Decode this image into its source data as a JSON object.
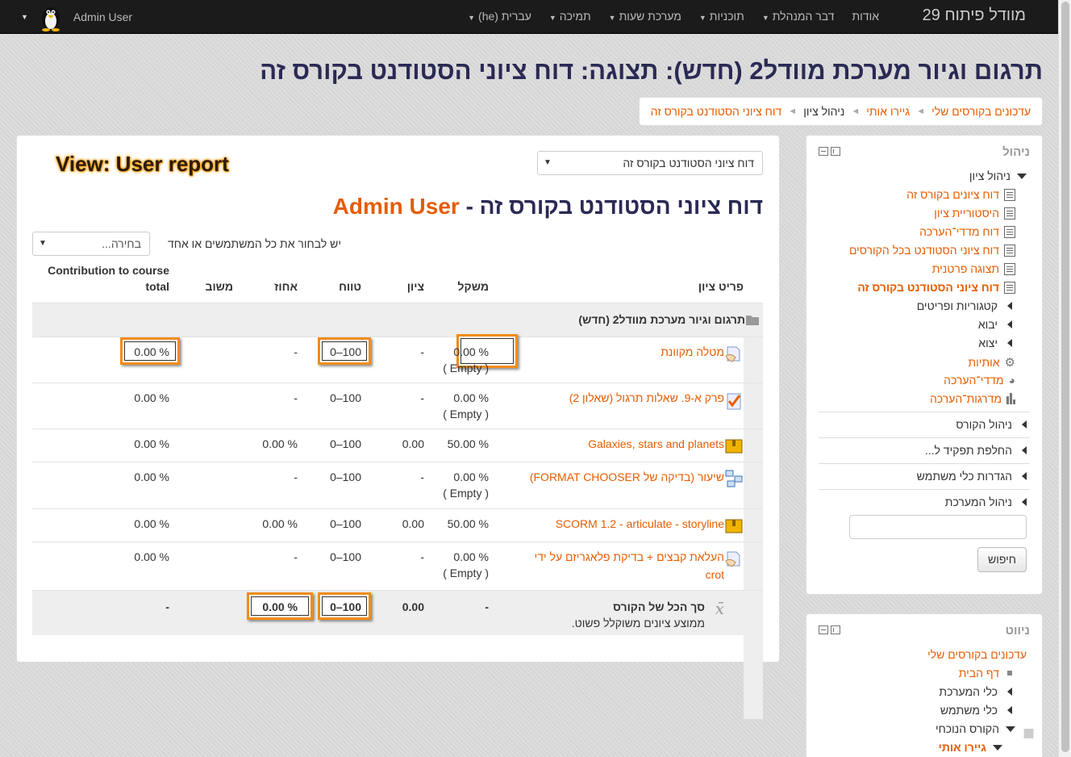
{
  "navbar": {
    "brand": "מוודל פיתוח 29",
    "menu": [
      {
        "label": "אודות",
        "caret": false
      },
      {
        "label": "דבר המנהלת",
        "caret": true
      },
      {
        "label": "תוכניות",
        "caret": true
      },
      {
        "label": "מערכת שעות",
        "caret": true
      },
      {
        "label": "תמיכה",
        "caret": true
      },
      {
        "label": "עברית (he)",
        "caret": true
      }
    ],
    "user_name": "Admin User"
  },
  "page_title": "תרגום וגיור מערכת מוודל2 (חדש): תצוגה: דוח ציוני הסטודנט בקורס זה",
  "breadcrumb": [
    "עדכונים בקורסים שלי",
    "גיירו אותי",
    "ניהול ציון",
    "דוח ציוני הסטודנט בקורס זה"
  ],
  "main": {
    "view_label": "View: User report",
    "report_select": "דוח ציוני הסטודנט בקורס זה",
    "heading_prefix": "דוח ציוני הסטודנט בקורס זה - ",
    "heading_user": "Admin User",
    "user_select_label": "יש לבחור את כל המשתמשים או אחד",
    "user_select_value": "בחירה...",
    "columns": {
      "item": "פריט ציון",
      "weight": "משקל",
      "grade": "ציון",
      "range": "טווח",
      "percentage": "אחוז",
      "feedback": "משוב",
      "contribution_line1": "Contribution to course",
      "contribution_line2": "total"
    },
    "category": "תרגום וגיור מערכת מוודל2 (חדש)",
    "rows": [
      {
        "name": "מטלה מקוונת",
        "weight": "0.00 %",
        "weight_note": "( Empty )",
        "grade": "-",
        "range": "0–100",
        "percentage": "-",
        "contribution": "0.00 %"
      },
      {
        "name": "פרק א-9. שאלות תרגול (שאלון 2)",
        "weight": "0.00 %",
        "weight_note": "( Empty )",
        "grade": "-",
        "range": "0–100",
        "percentage": "-",
        "contribution": "0.00 %"
      },
      {
        "name": "Galaxies, stars and planets",
        "weight": "50.00 %",
        "weight_note": "",
        "grade": "0.00",
        "range": "0–100",
        "percentage": "0.00 %",
        "contribution": "0.00 %"
      },
      {
        "name": "שיעור (בדיקה של FORMAT CHOOSER)",
        "weight": "0.00 %",
        "weight_note": "( Empty )",
        "grade": "-",
        "range": "0–100",
        "percentage": "-",
        "contribution": "0.00 %"
      },
      {
        "name": "SCORM 1.2 - articulate - storyline",
        "weight": "50.00 %",
        "weight_note": "",
        "grade": "0.00",
        "range": "0–100",
        "percentage": "0.00 %",
        "contribution": "0.00 %"
      },
      {
        "name": "העלאת קבצים + בדיקת פלאגריזם על ידי",
        "name2": "crot",
        "weight": "0.00 %",
        "weight_note": "( Empty )",
        "grade": "-",
        "range": "0–100",
        "percentage": "-",
        "contribution": "0.00 %"
      }
    ],
    "total": {
      "name": "סך הכל של הקורס",
      "note": "ממוצע ציונים משוקלל פשוט.",
      "weight": "-",
      "grade": "0.00",
      "range": "0–100",
      "percentage": "0.00 %",
      "contribution": "-"
    }
  },
  "admin_block": {
    "title": "ניהול",
    "grade_admin": "ניהול ציון",
    "reports": [
      "דוח ציונים בקורס זה",
      "היסטוריית ציון",
      "דוח מדדי־הערכה",
      "דוח ציוני הסטודנט בכל הקורסים",
      "תצוגה פרטנית",
      "דוח ציוני הסטודנט בקורס זה"
    ],
    "collapsed": [
      "קטגוריות ופריטים",
      "יבוא",
      "יצוא"
    ],
    "links": [
      "אותיות",
      "מדדי־הערכה",
      "מדרגות־הערכה"
    ],
    "sections": [
      "ניהול הקורס",
      "החלפת תפקיד ל...",
      "הגדרות כלי משתמש",
      "ניהול המערכת"
    ],
    "search_button": "חיפוש"
  },
  "nav_block": {
    "title": "ניווט",
    "my_courses": "עדכונים בקורסים שלי",
    "home": "דף הבית",
    "items": [
      "כלי המערכת",
      "כלי משתמש"
    ],
    "current_course": "הקורס הנוכחי",
    "course": "גיירו אותי"
  }
}
